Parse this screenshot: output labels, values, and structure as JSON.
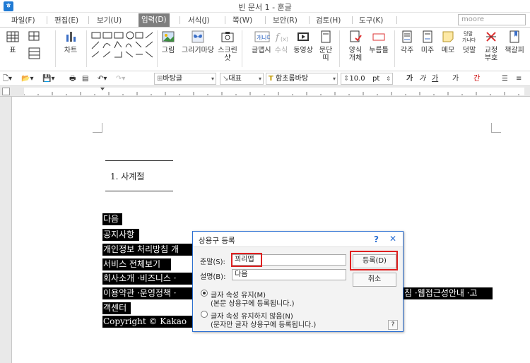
{
  "window": {
    "title": "빈 문서 1 - 훈글",
    "app_icon_letter": "ㅎ"
  },
  "menubar": {
    "items": [
      "파일(F)",
      "편집(E)",
      "보기(U)",
      "입력(D)",
      "서식(J)",
      "쪽(W)",
      "보안(R)",
      "검토(H)",
      "도구(K)"
    ],
    "active_index": 3,
    "search_placeholder": "moore"
  },
  "ribbon": {
    "table": "표",
    "chart": "차트",
    "picture": "그림",
    "paint": "그리기마당",
    "screenshot_line1": "스크린",
    "screenshot_line2": "샷",
    "caption": "글맵시",
    "formula": "수식",
    "video": "동영상",
    "paragraph_line1": "문단",
    "paragraph_line2": "띠",
    "form_line1": "양식",
    "form_line2": "개체",
    "button": "누름틀",
    "footnote": "각주",
    "endnote": "미주",
    "memo": "메모",
    "comment": "덧말",
    "revise_line1": "교정",
    "revise_line2": "부호",
    "bookmark": "책갈피",
    "comment_icon_text": "덧말\n가나다"
  },
  "toolbar2": {
    "style": "바탕글",
    "lang": "대표",
    "font": "함초롬바탕",
    "size": "10.0",
    "unit": "pt",
    "char_buttons": [
      "가",
      "가",
      "가",
      "가",
      "간"
    ]
  },
  "document": {
    "heading": "1.  사계절",
    "lines": [
      "다음",
      "공지사항",
      "개인정보 처리방침  개",
      "서비스 전체보기",
      "회사소개 ·비즈니스 ·",
      "이용약관 ·운영정책 ·",
      "객센터",
      "Copyright © Kakao"
    ],
    "right_text": "침  ·웹접근성안내 ·고"
  },
  "dialog": {
    "title": "상용구 등록",
    "help": "?",
    "close": "✕",
    "shortcut_label": "준말(S):",
    "shortcut_value": "꾀리맵",
    "desc_label": "설명(B):",
    "desc_value": "다음",
    "register_button": "등록(D)",
    "cancel_button": "취소",
    "option1_label": "글자 속성 유지(M)",
    "option1_note": "(본문 상용구에 등록됩니다.)",
    "option2_label": "글자 속성 유지하지 않음(N)",
    "option2_note": "(문자만 글자 상용구에 등록됩니다.)",
    "help_button": "?"
  },
  "colors": {
    "accent": "#2a6ed1",
    "highlight_box": "#e02020",
    "active_menu": "#7e7e7e"
  }
}
